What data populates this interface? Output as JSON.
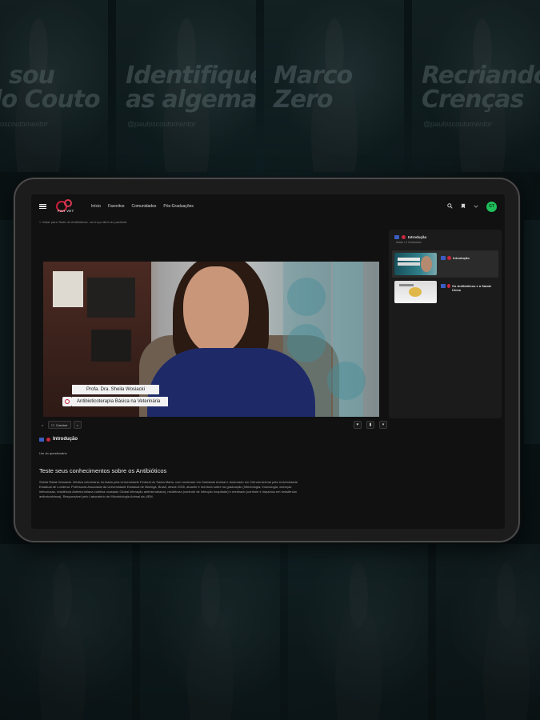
{
  "background": {
    "top_posters": [
      {
        "kicker": "",
        "title": "a, sou\nulo Couto",
        "handle": "@pauloscoutomentor"
      },
      {
        "kicker": "",
        "title": "Identifique\nas algemas",
        "handle": "@pauloscoutomentor"
      },
      {
        "kicker": "",
        "title": "Marco\nZero",
        "handle": ""
      },
      {
        "kicker": "",
        "title": "Recriando\nCrenças",
        "handle": "@pauloscoutomentor"
      }
    ]
  },
  "nav": {
    "links": [
      "Início",
      "Favoritos",
      "Comunidades",
      "Pós-Graduações"
    ],
    "avatar_initials": "GT",
    "logo_text": "PAH VET",
    "search_icon": "search-icon",
    "bookmark_icon": "bookmark-icon",
    "chevron_icon": "chevron-down-icon"
  },
  "breadcrumb": "< Voltar para Teste de Antibióticos: um troço além do paciente",
  "video": {
    "presenter_name": "Profa. Dra. Sheila Wosiacki",
    "course_name": "Antibioticoterapia Básica na Veterinária"
  },
  "controls": {
    "prev": "<",
    "complete": "Concluir",
    "next": ">"
  },
  "lesson": {
    "title": "Introdução",
    "subtitle": "Um do questionário",
    "heading": "Teste seus conhecimentos sobre os Antibióticos",
    "description": "Sheila Rafae Wosiacki. Médica veterinária, formada pela Universidade Federal do Santa Maria, com mestrado em Sanidade Animal e doutorado em Ciência Animal pela Universidade Estadual de Londrina. Professora Associada da Universidade Estadual de Maringá, Brasil, desde 2005, atuante e mentora sobre na graduação (Infectologia, Imunologia, doenças infecciosas, residência Antimicrobiana coletiva ocasiado Global interação antimicrobiana), residência (controle de infecção hospitalar) e mestrado (controle e impactos em resistência antimicrobiana). Responsável pelo Laboratório de Microbiologia Animal da UEM."
  },
  "sidebar": {
    "module_title": "Introdução",
    "module_subtitle": "Aulas • 2 Conteúdos",
    "items": [
      {
        "label": "Introdução",
        "active": true
      },
      {
        "label": "Os Antibióticos e a Saúde Única",
        "active": false
      }
    ]
  },
  "colors": {
    "accent_red": "#c81e3a",
    "avatar_green": "#1fbf5b",
    "screen_bg": "#111111"
  }
}
